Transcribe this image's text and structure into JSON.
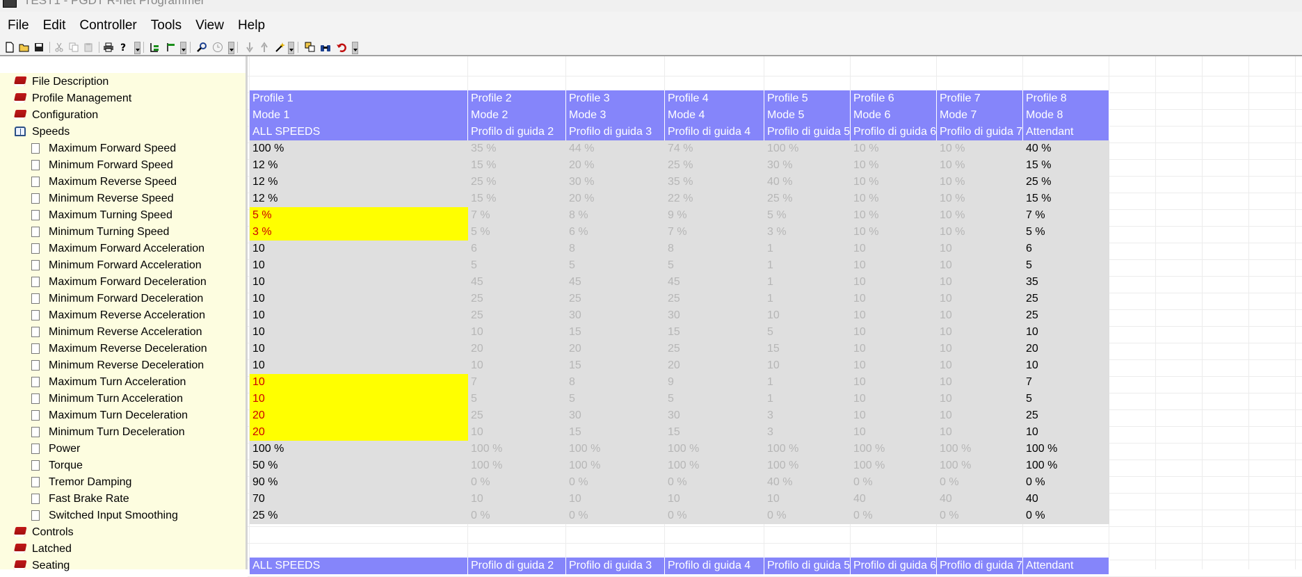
{
  "window": {
    "title": "TEST1 - PGDT R-net Programmer"
  },
  "menu": [
    "File",
    "Edit",
    "Controller",
    "Tools",
    "View",
    "Help"
  ],
  "toolbar": {
    "icons": [
      "new-file-icon",
      "open-folder-icon",
      "save-disk-icon",
      "cut-scissors-icon",
      "copy-icon",
      "paste-icon",
      "print-icon",
      "help-icon",
      "tree-expand-icon",
      "tree-collapse-icon",
      "search-magnifier-icon",
      "clock-icon",
      "arrow-down-icon",
      "arrow-up-icon",
      "wand-icon",
      "compare-icon",
      "binoculars-icon",
      "undo-icon"
    ]
  },
  "tree": {
    "items": [
      {
        "label": "File Description",
        "kind": "book",
        "level": 0
      },
      {
        "label": "Profile Management",
        "kind": "book",
        "level": 0
      },
      {
        "label": "Configuration",
        "kind": "book",
        "level": 0
      },
      {
        "label": "Speeds",
        "kind": "book-open",
        "level": 0
      },
      {
        "label": "Maximum Forward Speed",
        "kind": "page",
        "level": 1
      },
      {
        "label": "Minimum Forward Speed",
        "kind": "page",
        "level": 1
      },
      {
        "label": "Maximum Reverse Speed",
        "kind": "page",
        "level": 1
      },
      {
        "label": "Minimum Reverse Speed",
        "kind": "page",
        "level": 1
      },
      {
        "label": "Maximum Turning Speed",
        "kind": "page",
        "level": 1
      },
      {
        "label": "Minimum Turning Speed",
        "kind": "page",
        "level": 1
      },
      {
        "label": "Maximum Forward Acceleration",
        "kind": "page",
        "level": 1
      },
      {
        "label": "Minimum Forward Acceleration",
        "kind": "page",
        "level": 1
      },
      {
        "label": "Maximum Forward Deceleration",
        "kind": "page",
        "level": 1
      },
      {
        "label": "Minimum Forward Deceleration",
        "kind": "page",
        "level": 1
      },
      {
        "label": "Maximum Reverse Acceleration",
        "kind": "page",
        "level": 1
      },
      {
        "label": "Minimum Reverse Acceleration",
        "kind": "page",
        "level": 1
      },
      {
        "label": "Maximum Reverse Deceleration",
        "kind": "page",
        "level": 1
      },
      {
        "label": "Minimum Reverse Deceleration",
        "kind": "page",
        "level": 1
      },
      {
        "label": "Maximum Turn Acceleration",
        "kind": "page",
        "level": 1
      },
      {
        "label": "Minimum Turn Acceleration",
        "kind": "page",
        "level": 1
      },
      {
        "label": "Maximum Turn Deceleration",
        "kind": "page",
        "level": 1
      },
      {
        "label": "Minimum Turn Deceleration",
        "kind": "page",
        "level": 1
      },
      {
        "label": "Power",
        "kind": "page",
        "level": 1
      },
      {
        "label": "Torque",
        "kind": "page",
        "level": 1
      },
      {
        "label": "Tremor Damping",
        "kind": "page",
        "level": 1
      },
      {
        "label": "Fast Brake Rate",
        "kind": "page",
        "level": 1
      },
      {
        "label": "Switched Input Smoothing",
        "kind": "page",
        "level": 1
      },
      {
        "label": "Controls",
        "kind": "book",
        "level": 0
      },
      {
        "label": "Latched",
        "kind": "book",
        "level": 0
      },
      {
        "label": "Seating",
        "kind": "book",
        "level": 0
      }
    ]
  },
  "grid": {
    "header_rows": [
      [
        "Profile 1",
        "Profile 2",
        "Profile 3",
        "Profile 4",
        "Profile 5",
        "Profile 6",
        "Profile 7",
        "Profile 8"
      ],
      [
        "Mode 1",
        "Mode 2",
        "Mode 3",
        "Mode 4",
        "Mode 5",
        "Mode 6",
        "Mode 7",
        "Mode 8"
      ],
      [
        "ALL SPEEDS",
        "Profilo di guida 2",
        "Profilo di guida 3",
        "Profilo di guida 4",
        "Profilo di guida 5",
        "Profilo di guida 6",
        "Profilo di guida 7",
        "Attendant"
      ]
    ],
    "active_columns": [
      0,
      7
    ],
    "highlighted_rows": [
      4,
      5,
      14,
      15,
      16,
      17
    ],
    "rows": [
      [
        "100 %",
        "35 %",
        "44 %",
        "74 %",
        "100 %",
        "10 %",
        "10 %",
        "40 %"
      ],
      [
        "12 %",
        "15 %",
        "20 %",
        "25 %",
        "30 %",
        "10 %",
        "10 %",
        "15 %"
      ],
      [
        "12 %",
        "25 %",
        "30 %",
        "35 %",
        "40 %",
        "10 %",
        "10 %",
        "25 %"
      ],
      [
        "12 %",
        "15 %",
        "20 %",
        "22 %",
        "25 %",
        "10 %",
        "10 %",
        "15 %"
      ],
      [
        "5 %",
        "7 %",
        "8 %",
        "9 %",
        "5 %",
        "10 %",
        "10 %",
        "7 %"
      ],
      [
        "3 %",
        "5 %",
        "6 %",
        "7 %",
        "3 %",
        "10 %",
        "10 %",
        "5 %"
      ],
      [
        "10",
        "6",
        "8",
        "8",
        "1",
        "10",
        "10",
        "6"
      ],
      [
        "10",
        "5",
        "5",
        "5",
        "1",
        "10",
        "10",
        "5"
      ],
      [
        "10",
        "45",
        "45",
        "45",
        "1",
        "10",
        "10",
        "35"
      ],
      [
        "10",
        "25",
        "25",
        "25",
        "1",
        "10",
        "10",
        "25"
      ],
      [
        "10",
        "25",
        "30",
        "30",
        "10",
        "10",
        "10",
        "25"
      ],
      [
        "10",
        "10",
        "15",
        "15",
        "5",
        "10",
        "10",
        "10"
      ],
      [
        "10",
        "20",
        "20",
        "25",
        "15",
        "10",
        "10",
        "20"
      ],
      [
        "10",
        "10",
        "15",
        "20",
        "10",
        "10",
        "10",
        "10"
      ],
      [
        "10",
        "7",
        "8",
        "9",
        "1",
        "10",
        "10",
        "7"
      ],
      [
        "10",
        "5",
        "5",
        "5",
        "1",
        "10",
        "10",
        "5"
      ],
      [
        "20",
        "25",
        "30",
        "30",
        "3",
        "10",
        "10",
        "25"
      ],
      [
        "20",
        "10",
        "15",
        "15",
        "3",
        "10",
        "10",
        "10"
      ],
      [
        "100 %",
        "100 %",
        "100 %",
        "100 %",
        "100 %",
        "100 %",
        "100 %",
        "100 %"
      ],
      [
        "50 %",
        "100 %",
        "100 %",
        "100 %",
        "100 %",
        "100 %",
        "100 %",
        "100 %"
      ],
      [
        "90 %",
        "0 %",
        "0 %",
        "0 %",
        "40 %",
        "0 %",
        "0 %",
        "0 %"
      ],
      [
        "70",
        "10",
        "10",
        "10",
        "10",
        "40",
        "40",
        "40"
      ],
      [
        "25 %",
        "0 %",
        "0 %",
        "0 %",
        "0 %",
        "0 %",
        "0 %",
        "0 %"
      ]
    ],
    "bottom_header": [
      "ALL SPEEDS",
      "Profilo di guida 2",
      "Profilo di guida 3",
      "Profilo di guida 4",
      "Profilo di guida 5",
      "Profilo di guida 6",
      "Profilo di guida 7",
      "Attendant"
    ]
  },
  "colors": {
    "header_bg": "#8585fa",
    "header_text": "#ffffff",
    "data_bg": "#dfdfdf",
    "inactive_text": "#b6b6b6",
    "highlight_bg": "#ffff00",
    "highlight_text": "#cc0000",
    "tree_bg": "#fdfde0",
    "book_closed": "#b01010",
    "book_open": "#2b4f85"
  }
}
